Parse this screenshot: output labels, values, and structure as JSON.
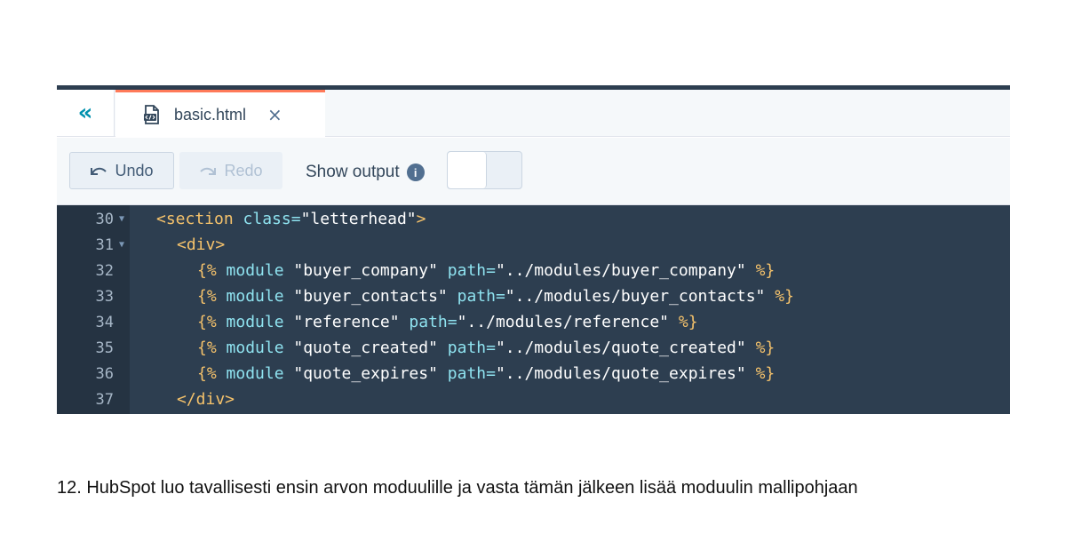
{
  "tab": {
    "filename": "basic.html",
    "close": "×"
  },
  "toolbar": {
    "undo": "Undo",
    "redo": "Redo",
    "show_output": "Show output"
  },
  "code_lines": [
    {
      "num": "30",
      "fold": true,
      "segments": [
        [
          "tag",
          "<section "
        ],
        [
          "attr",
          "class="
        ],
        [
          "str",
          "\"letterhead\""
        ],
        [
          "tag",
          ">"
        ]
      ],
      "indent": 0
    },
    {
      "num": "31",
      "fold": true,
      "segments": [
        [
          "tag",
          "<div>"
        ]
      ],
      "indent": 1
    },
    {
      "num": "32",
      "fold": false,
      "segments": [
        [
          "delim",
          "{% "
        ],
        [
          "kw",
          "module "
        ],
        [
          "str",
          "\"buyer_company\" "
        ],
        [
          "kw",
          "path="
        ],
        [
          "str",
          "\"../modules/buyer_company\" "
        ],
        [
          "delim",
          "%}"
        ]
      ],
      "indent": 2
    },
    {
      "num": "33",
      "fold": false,
      "segments": [
        [
          "delim",
          "{% "
        ],
        [
          "kw",
          "module "
        ],
        [
          "str",
          "\"buyer_contacts\" "
        ],
        [
          "kw",
          "path="
        ],
        [
          "str",
          "\"../modules/buyer_contacts\" "
        ],
        [
          "delim",
          "%}"
        ]
      ],
      "indent": 2
    },
    {
      "num": "34",
      "fold": false,
      "segments": [
        [
          "delim",
          "{% "
        ],
        [
          "kw",
          "module "
        ],
        [
          "str",
          "\"reference\" "
        ],
        [
          "kw",
          "path="
        ],
        [
          "str",
          "\"../modules/reference\" "
        ],
        [
          "delim",
          "%}"
        ]
      ],
      "indent": 2
    },
    {
      "num": "35",
      "fold": false,
      "segments": [
        [
          "delim",
          "{% "
        ],
        [
          "kw",
          "module "
        ],
        [
          "str",
          "\"quote_created\" "
        ],
        [
          "kw",
          "path="
        ],
        [
          "str",
          "\"../modules/quote_created\" "
        ],
        [
          "delim",
          "%}"
        ]
      ],
      "indent": 2
    },
    {
      "num": "36",
      "fold": false,
      "segments": [
        [
          "delim",
          "{% "
        ],
        [
          "kw",
          "module "
        ],
        [
          "str",
          "\"quote_expires\" "
        ],
        [
          "kw",
          "path="
        ],
        [
          "str",
          "\"../modules/quote_expires\" "
        ],
        [
          "delim",
          "%}"
        ]
      ],
      "indent": 2
    },
    {
      "num": "37",
      "fold": false,
      "segments": [
        [
          "tag",
          "</div>"
        ]
      ],
      "indent": 1
    }
  ],
  "caption": "12. HubSpot luo tavallisesti ensin arvon moduulille ja vasta tämän jälkeen lisää moduulin mallipohjaan",
  "colors": {
    "accent_tab": "#ff7a59",
    "code_bg": "#2d3e50",
    "link_teal": "#0091ae"
  },
  "icons": {
    "collapse": "double-chevron-left-icon",
    "file": "html-file-icon",
    "undo": "undo-arrow-icon",
    "redo": "redo-arrow-icon",
    "info": "info-icon"
  }
}
